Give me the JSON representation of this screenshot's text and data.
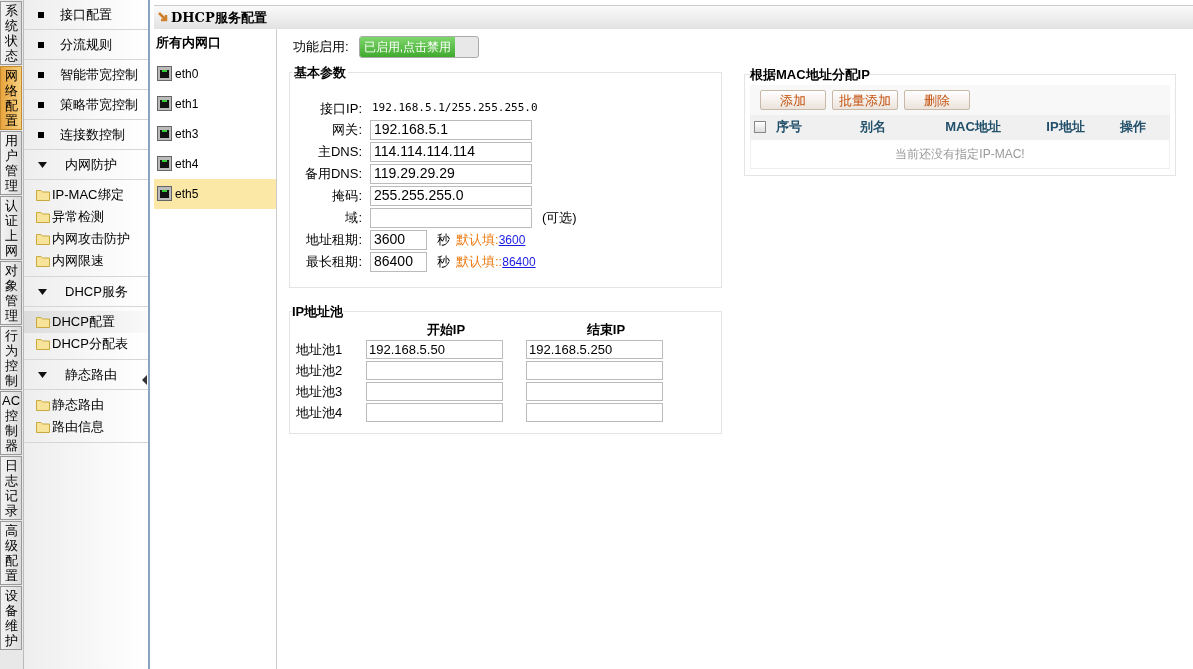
{
  "vertical_tabs": [
    {
      "label": "系统状态",
      "selected": false
    },
    {
      "label": "网络配置",
      "selected": true
    },
    {
      "label": "用户管理",
      "selected": false
    },
    {
      "label": "认证上网",
      "selected": false
    },
    {
      "label": "对象管理",
      "selected": false
    },
    {
      "label": "行为控制",
      "selected": false
    },
    {
      "label": "AC控制器",
      "selected": false
    },
    {
      "label": "日志记录",
      "selected": false
    },
    {
      "label": "高级配置",
      "selected": false
    },
    {
      "label": "设备维护",
      "selected": false
    }
  ],
  "menu": [
    {
      "kind": "item",
      "label": "接口配置"
    },
    {
      "kind": "item",
      "label": "分流规则"
    },
    {
      "kind": "item",
      "label": "智能带宽控制"
    },
    {
      "kind": "item",
      "label": "策略带宽控制"
    },
    {
      "kind": "item",
      "label": "连接数控制"
    },
    {
      "kind": "group",
      "label": "内网防护",
      "expanded": true,
      "children": [
        {
          "label": "IP-MAC绑定",
          "selected": false
        },
        {
          "label": "异常检测",
          "selected": false
        },
        {
          "label": "内网攻击防护",
          "selected": false
        },
        {
          "label": "内网限速",
          "selected": false
        }
      ]
    },
    {
      "kind": "group",
      "label": "DHCP服务",
      "expanded": true,
      "children": [
        {
          "label": "DHCP配置",
          "selected": true
        },
        {
          "label": "DHCP分配表",
          "selected": false
        }
      ]
    },
    {
      "kind": "group",
      "label": "静态路由",
      "expanded": true,
      "children": [
        {
          "label": "静态路由",
          "selected": false
        },
        {
          "label": "路由信息",
          "selected": false
        }
      ]
    }
  ],
  "header": {
    "title": "DHCP服务配置"
  },
  "interfaces": {
    "title": "所有内网口",
    "items": [
      {
        "label": "eth0",
        "selected": false
      },
      {
        "label": "eth1",
        "selected": false
      },
      {
        "label": "eth3",
        "selected": false
      },
      {
        "label": "eth4",
        "selected": false
      },
      {
        "label": "eth5",
        "selected": true
      }
    ]
  },
  "enable": {
    "label": "功能启用:",
    "button": "已启用,点击禁用",
    "on": true
  },
  "basic": {
    "title": "基本参数",
    "interface_ip": {
      "label": "接口IP:",
      "value": "192.168.5.1/255.255.255.0"
    },
    "fields": [
      {
        "kind": "text",
        "label": "网关:",
        "value": "192.168.5.1"
      },
      {
        "kind": "text",
        "label": "主DNS:",
        "value": "114.114.114.114"
      },
      {
        "kind": "text",
        "label": "备用DNS:",
        "value": "119.29.29.29"
      },
      {
        "kind": "text",
        "label": "掩码:",
        "value": "255.255.255.0"
      },
      {
        "kind": "text",
        "label": "域:",
        "hint": "(可选)"
      },
      {
        "kind": "lease",
        "label": "地址租期:",
        "value": "3600",
        "unit": "秒",
        "default_label": "默认填:",
        "default_link": "3600"
      },
      {
        "kind": "lease",
        "label": "最长租期:",
        "value": "86400",
        "unit": "秒",
        "default_label": "默认填::",
        "default_link": "86400"
      }
    ]
  },
  "pool": {
    "title": "IP地址池",
    "columns": [
      "开始IP",
      "结束IP"
    ],
    "rows": [
      {
        "label": "地址池1",
        "start": "192.168.5.50",
        "end": "192.168.5.250"
      },
      {
        "label": "地址池2"
      },
      {
        "label": "地址池3"
      },
      {
        "label": "地址池4"
      }
    ]
  },
  "mac": {
    "title": "根据MAC地址分配IP",
    "buttons": [
      "添加",
      "批量添加",
      "删除"
    ],
    "select_all_checked": false,
    "columns": [
      "序号",
      "别名",
      "MAC地址",
      "IP地址",
      "操作"
    ],
    "empty_message": "当前还没有指定IP-MAC!"
  }
}
